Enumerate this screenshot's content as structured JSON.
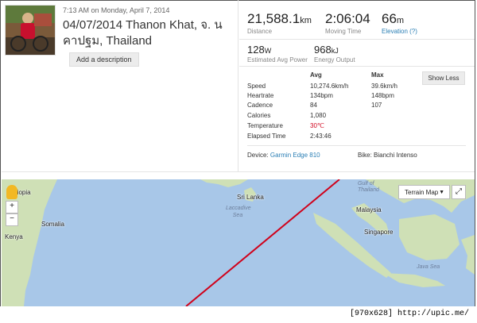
{
  "activity": {
    "datetime": "7:13 AM on Monday, April 7, 2014",
    "title": "04/07/2014 Thanon Khat, จ. นคาปฐม, Thailand",
    "add_description": "Add a description"
  },
  "summary": {
    "distance": {
      "value": "21,588.1",
      "unit": "km",
      "label": "Distance"
    },
    "moving_time": {
      "value": "2:06:04",
      "label": "Moving Time"
    },
    "elevation": {
      "value": "66",
      "unit": "m",
      "label": "Elevation (?)"
    },
    "power": {
      "value": "128",
      "unit": "W",
      "label": "Estimated Avg Power"
    },
    "energy": {
      "value": "968",
      "unit": "kJ",
      "label": "Energy Output"
    }
  },
  "details": {
    "col_avg": "Avg",
    "col_max": "Max",
    "show_less": "Show Less",
    "rows": [
      {
        "label": "Speed",
        "avg": "10,274.6km/h",
        "max": "39.6km/h"
      },
      {
        "label": "Heartrate",
        "avg": "134bpm",
        "max": "148bpm"
      },
      {
        "label": "Cadence",
        "avg": "84",
        "max": "107"
      },
      {
        "label": "Calories",
        "avg": "1,080",
        "max": ""
      },
      {
        "label": "Temperature",
        "avg": "30℃",
        "max": ""
      },
      {
        "label": "Elapsed Time",
        "avg": "2:43:46",
        "max": ""
      }
    ],
    "device_label": "Device:",
    "device_value": "Garmin Edge 810",
    "bike_label": "Bike:",
    "bike_value": "Bianchi Intenso"
  },
  "map": {
    "terrain_label": "Terrain Map",
    "labels": {
      "ethiopia": "thiopia",
      "kenya": "Kenya",
      "somalia": "Somalia",
      "sri_lanka": "Sri Lanka",
      "laccadive": "Laccadive Sea",
      "malaysia": "Malaysia",
      "singapore": "Singapore",
      "gulf": "Gulf of Thailand",
      "java": "Java Sea"
    },
    "route_color": "#d0021b",
    "ocean_color": "#a8c7e8",
    "land_color": "#cfe0b6"
  },
  "footer": {
    "text": "[970x628] http://upic.me/"
  }
}
